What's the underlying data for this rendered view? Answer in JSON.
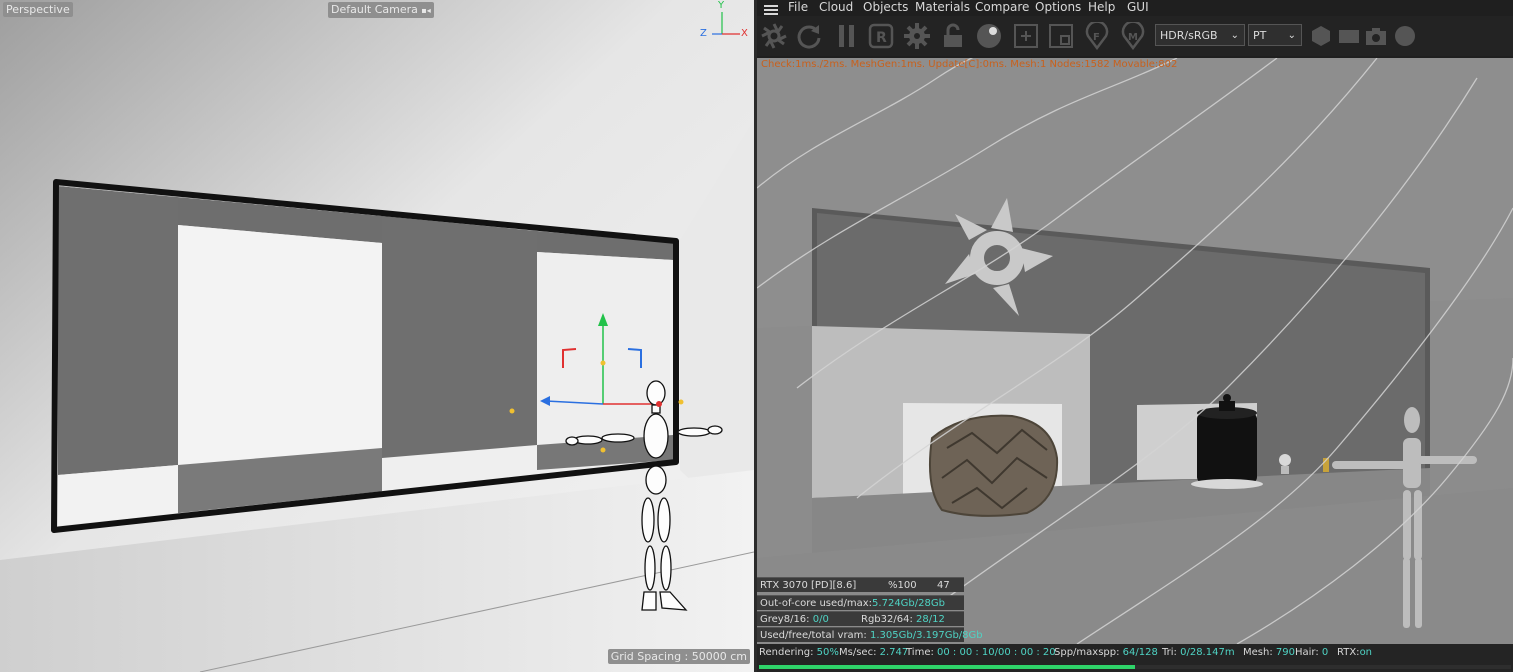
{
  "left_viewport": {
    "perspective_label": "Perspective",
    "camera_label": "Default Camera",
    "grid_label": "Grid Spacing : 50000 cm",
    "axes": {
      "y": "Y",
      "z": "Z",
      "x": "X"
    }
  },
  "menu": {
    "items": [
      "File",
      "Cloud",
      "Objects",
      "Materials",
      "Compare",
      "Options",
      "Help",
      "GUI"
    ]
  },
  "toolbar": {
    "icons": [
      "octane-logo-icon",
      "refresh-icon",
      "pause-icon",
      "region-render-icon",
      "settings-gear-icon",
      "lock-icon",
      "material-ball-icon",
      "add-region-icon",
      "film-region-icon",
      "focus-pick-icon",
      "material-pick-icon",
      "cube-icon",
      "box-icon",
      "camera-icon",
      "record-icon"
    ],
    "colorspace": "HDR/sRGB",
    "kernel": "PT"
  },
  "render_view": {
    "stats_line": "Check:1ms./2ms. MeshGen:1ms. Update[C]:0ms. Mesh:1 Nodes:1582 Movable:802"
  },
  "hud": {
    "gpu": "RTX 3070 [PD][8.6]",
    "gpu_pct": "%100",
    "gpu_temp": "47",
    "out_of_core_label": "Out-of-core used/max:",
    "out_of_core_value": "5.724Gb/28Gb",
    "grey_label": "Grey8/16:",
    "grey_value": "0/0",
    "rgb_label": "Rgb32/64:",
    "rgb_value": "28/12",
    "vram_label": "Used/free/total vram:",
    "vram_value": "1.305Gb/3.197Gb/8Gb"
  },
  "status": {
    "rendering_label": "Rendering:",
    "rendering_value": "50%",
    "ms_label": "Ms/sec:",
    "ms_value": "2.747",
    "time_label": "Time:",
    "time_value": "00 : 00 : 10/00 : 00 : 20",
    "spp_label": "Spp/maxspp:",
    "spp_value": "64/128",
    "tri_label": "Tri:",
    "tri_value": "0/28.147m",
    "mesh_label": "Mesh:",
    "mesh_value": "790",
    "hair_label": "Hair:",
    "hair_value": "0",
    "rtx_label": "RTX:",
    "rtx_value": "on",
    "progress": 0.5
  }
}
